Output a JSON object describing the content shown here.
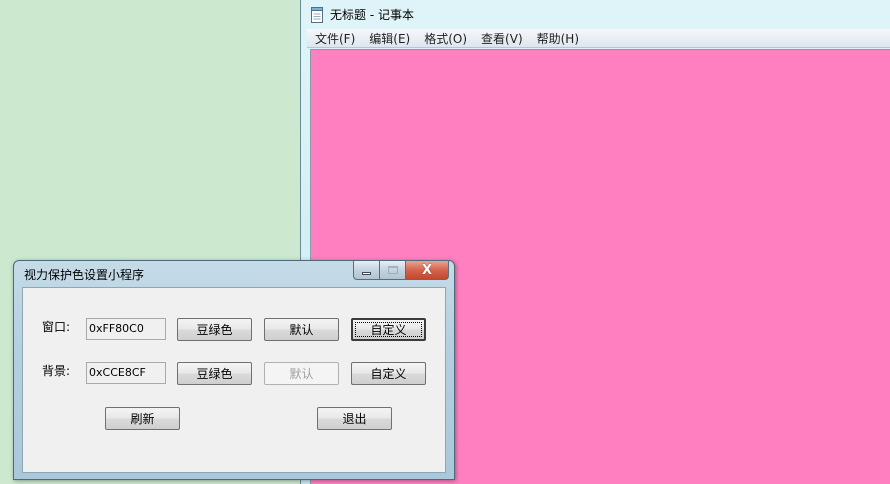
{
  "notepad": {
    "title": "无标题 - 记事本",
    "menu": [
      "文件(F)",
      "编辑(E)",
      "格式(O)",
      "查看(V)",
      "帮助(H)"
    ],
    "background_color": "#FF80C0"
  },
  "dialog": {
    "title": "视力保护色设置小程序",
    "caption": {
      "minimize_icon": "minimize-icon",
      "maximize_icon": "maximize-icon",
      "close_icon": "close-icon",
      "close_glyph": "X"
    },
    "window_row": {
      "label": "窗口:",
      "value": "0xFF80C0",
      "green_button": "豆绿色",
      "default_button": "默认",
      "custom_button": "自定义"
    },
    "background_row": {
      "label": "背景:",
      "value": "0xCCE8CF",
      "green_button": "豆绿色",
      "default_button": "默认",
      "custom_button": "自定义"
    },
    "refresh_button": "刷新",
    "exit_button": "退出"
  },
  "desktop_color": "#CCE8CF"
}
